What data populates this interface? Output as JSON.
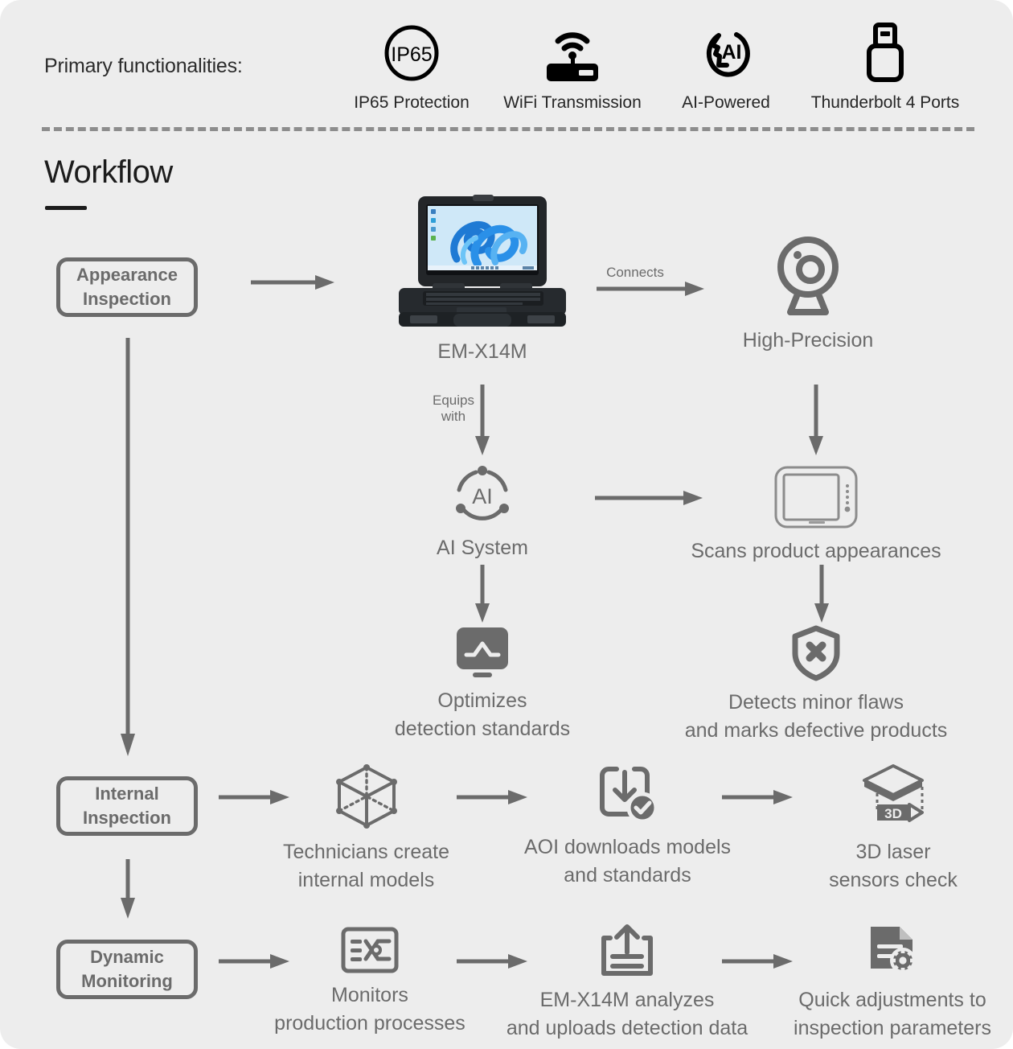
{
  "header": {
    "label": "Primary functionalities:",
    "features": [
      {
        "icon": "ip65-badge-icon",
        "label": "IP65 Protection"
      },
      {
        "icon": "wifi-router-icon",
        "label": "WiFi Transmission"
      },
      {
        "icon": "ai-head-icon",
        "label": "AI-Powered"
      },
      {
        "icon": "usb-thunderbolt-icon",
        "label": "Thunderbolt 4 Ports"
      }
    ]
  },
  "workflow": {
    "title": "Workflow",
    "stages": [
      {
        "id": "appearance",
        "label": "Appearance\nInspection"
      },
      {
        "id": "internal",
        "label": "Internal\nInspection"
      },
      {
        "id": "dynamic",
        "label": "Dynamic\nMonitoring"
      }
    ],
    "nodes": {
      "laptop": {
        "icon": "rugged-laptop-image",
        "caption": "EM-X14M"
      },
      "camera": {
        "icon": "webcam-icon",
        "caption": "High-Precision"
      },
      "ai_system": {
        "icon": "ai-circle-icon",
        "caption": "AI System"
      },
      "scanner": {
        "icon": "rugged-tablet-icon",
        "caption": "Scans product appearances"
      },
      "optimize": {
        "icon": "monitor-chart-icon",
        "caption": "Optimizes\ndetection standards"
      },
      "detect": {
        "icon": "shield-x-icon",
        "caption": "Detects minor flaws\nand marks defective products"
      },
      "models": {
        "icon": "wireframe-cube-icon",
        "caption": "Technicians create\ninternal models"
      },
      "download": {
        "icon": "download-check-icon",
        "caption": "AOI downloads models\nand standards"
      },
      "laser3d": {
        "icon": "3d-layers-icon",
        "caption": "3D laser\nsensors check"
      },
      "monitors": {
        "icon": "process-monitor-icon",
        "caption": "Monitors\nproduction processes"
      },
      "upload": {
        "icon": "upload-tray-icon",
        "caption": "EM-X14M analyzes\nand uploads detection data"
      },
      "adjust": {
        "icon": "document-gear-icon",
        "caption": "Quick adjustments to\ninspection parameters"
      }
    },
    "arrow_labels": {
      "connects": "Connects",
      "equips_with": "Equips\nwith"
    }
  },
  "colors": {
    "background": "#ededed",
    "ink": "#6b6b6b",
    "heading": "#1c1c1c",
    "icon_dark": "#000000",
    "screen_blue": "#2a7de1"
  }
}
